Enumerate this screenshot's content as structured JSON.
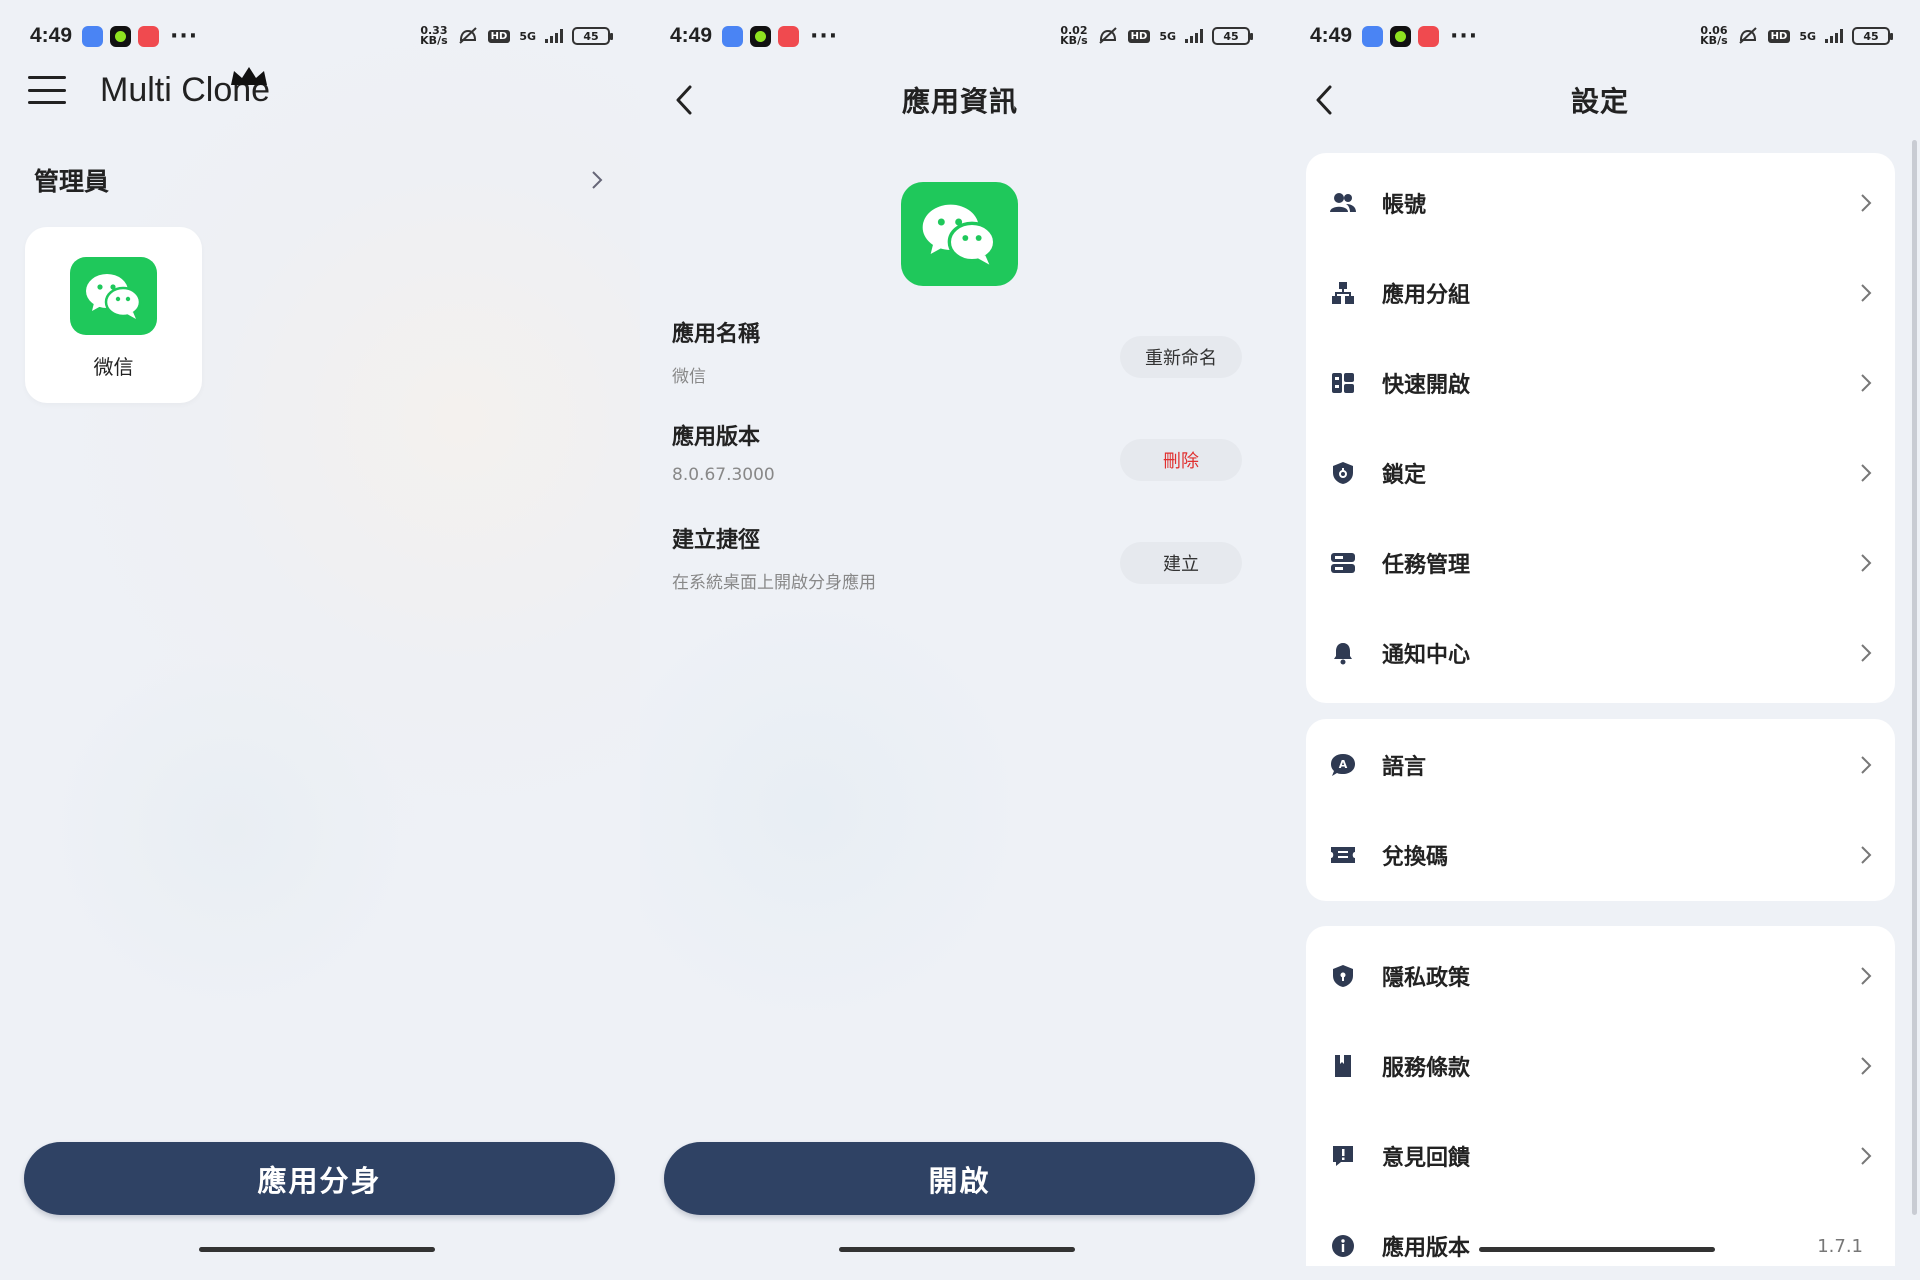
{
  "status_bars": [
    {
      "time": "4:49",
      "speed_top": "0.33",
      "speed_unit": "KB/s",
      "hd": "HD",
      "network": "5G",
      "battery": "45"
    },
    {
      "time": "4:49",
      "speed_top": "0.02",
      "speed_unit": "KB/s",
      "hd": "HD",
      "network": "5G",
      "battery": "45"
    },
    {
      "time": "4:49",
      "speed_top": "0.06",
      "speed_unit": "KB/s",
      "hd": "HD",
      "network": "5G",
      "battery": "45"
    }
  ],
  "status_more": "···",
  "home": {
    "brand": "Multi Clone",
    "section_label": "管理員",
    "apps": [
      {
        "name": "微信",
        "icon": "wechat-icon"
      }
    ],
    "bottom_button": "應用分身"
  },
  "app_info": {
    "title": "應用資訊",
    "rows": [
      {
        "key": "應用名稱",
        "value": "微信",
        "action": "重新命名"
      },
      {
        "key": "應用版本",
        "value": "8.0.67.3000",
        "action": "刪除"
      },
      {
        "key": "建立捷徑",
        "value": "在系統桌面上開啟分身應用",
        "action": "建立"
      }
    ],
    "bottom_button": "開啟"
  },
  "settings": {
    "title": "設定",
    "group1": [
      {
        "label": "帳號",
        "icon": "users-icon"
      },
      {
        "label": "應用分組",
        "icon": "hierarchy-icon"
      },
      {
        "label": "快速開啟",
        "icon": "quick-open-icon"
      },
      {
        "label": "鎖定",
        "icon": "shield-lock-icon"
      },
      {
        "label": "任務管理",
        "icon": "server-icon"
      },
      {
        "label": "通知中心",
        "icon": "bell-icon"
      }
    ],
    "group2": [
      {
        "label": "語言",
        "icon": "language-icon"
      },
      {
        "label": "兌換碼",
        "icon": "ticket-icon"
      }
    ],
    "group3": [
      {
        "label": "隱私政策",
        "icon": "privacy-shield-icon"
      },
      {
        "label": "服務條款",
        "icon": "book-icon"
      },
      {
        "label": "意見回饋",
        "icon": "feedback-icon"
      }
    ],
    "version_label": "應用版本",
    "version_value": "1.7.1"
  },
  "colors": {
    "primary_button": "#2f4264",
    "wechat_green": "#1fc85b",
    "danger": "#e0302f"
  }
}
